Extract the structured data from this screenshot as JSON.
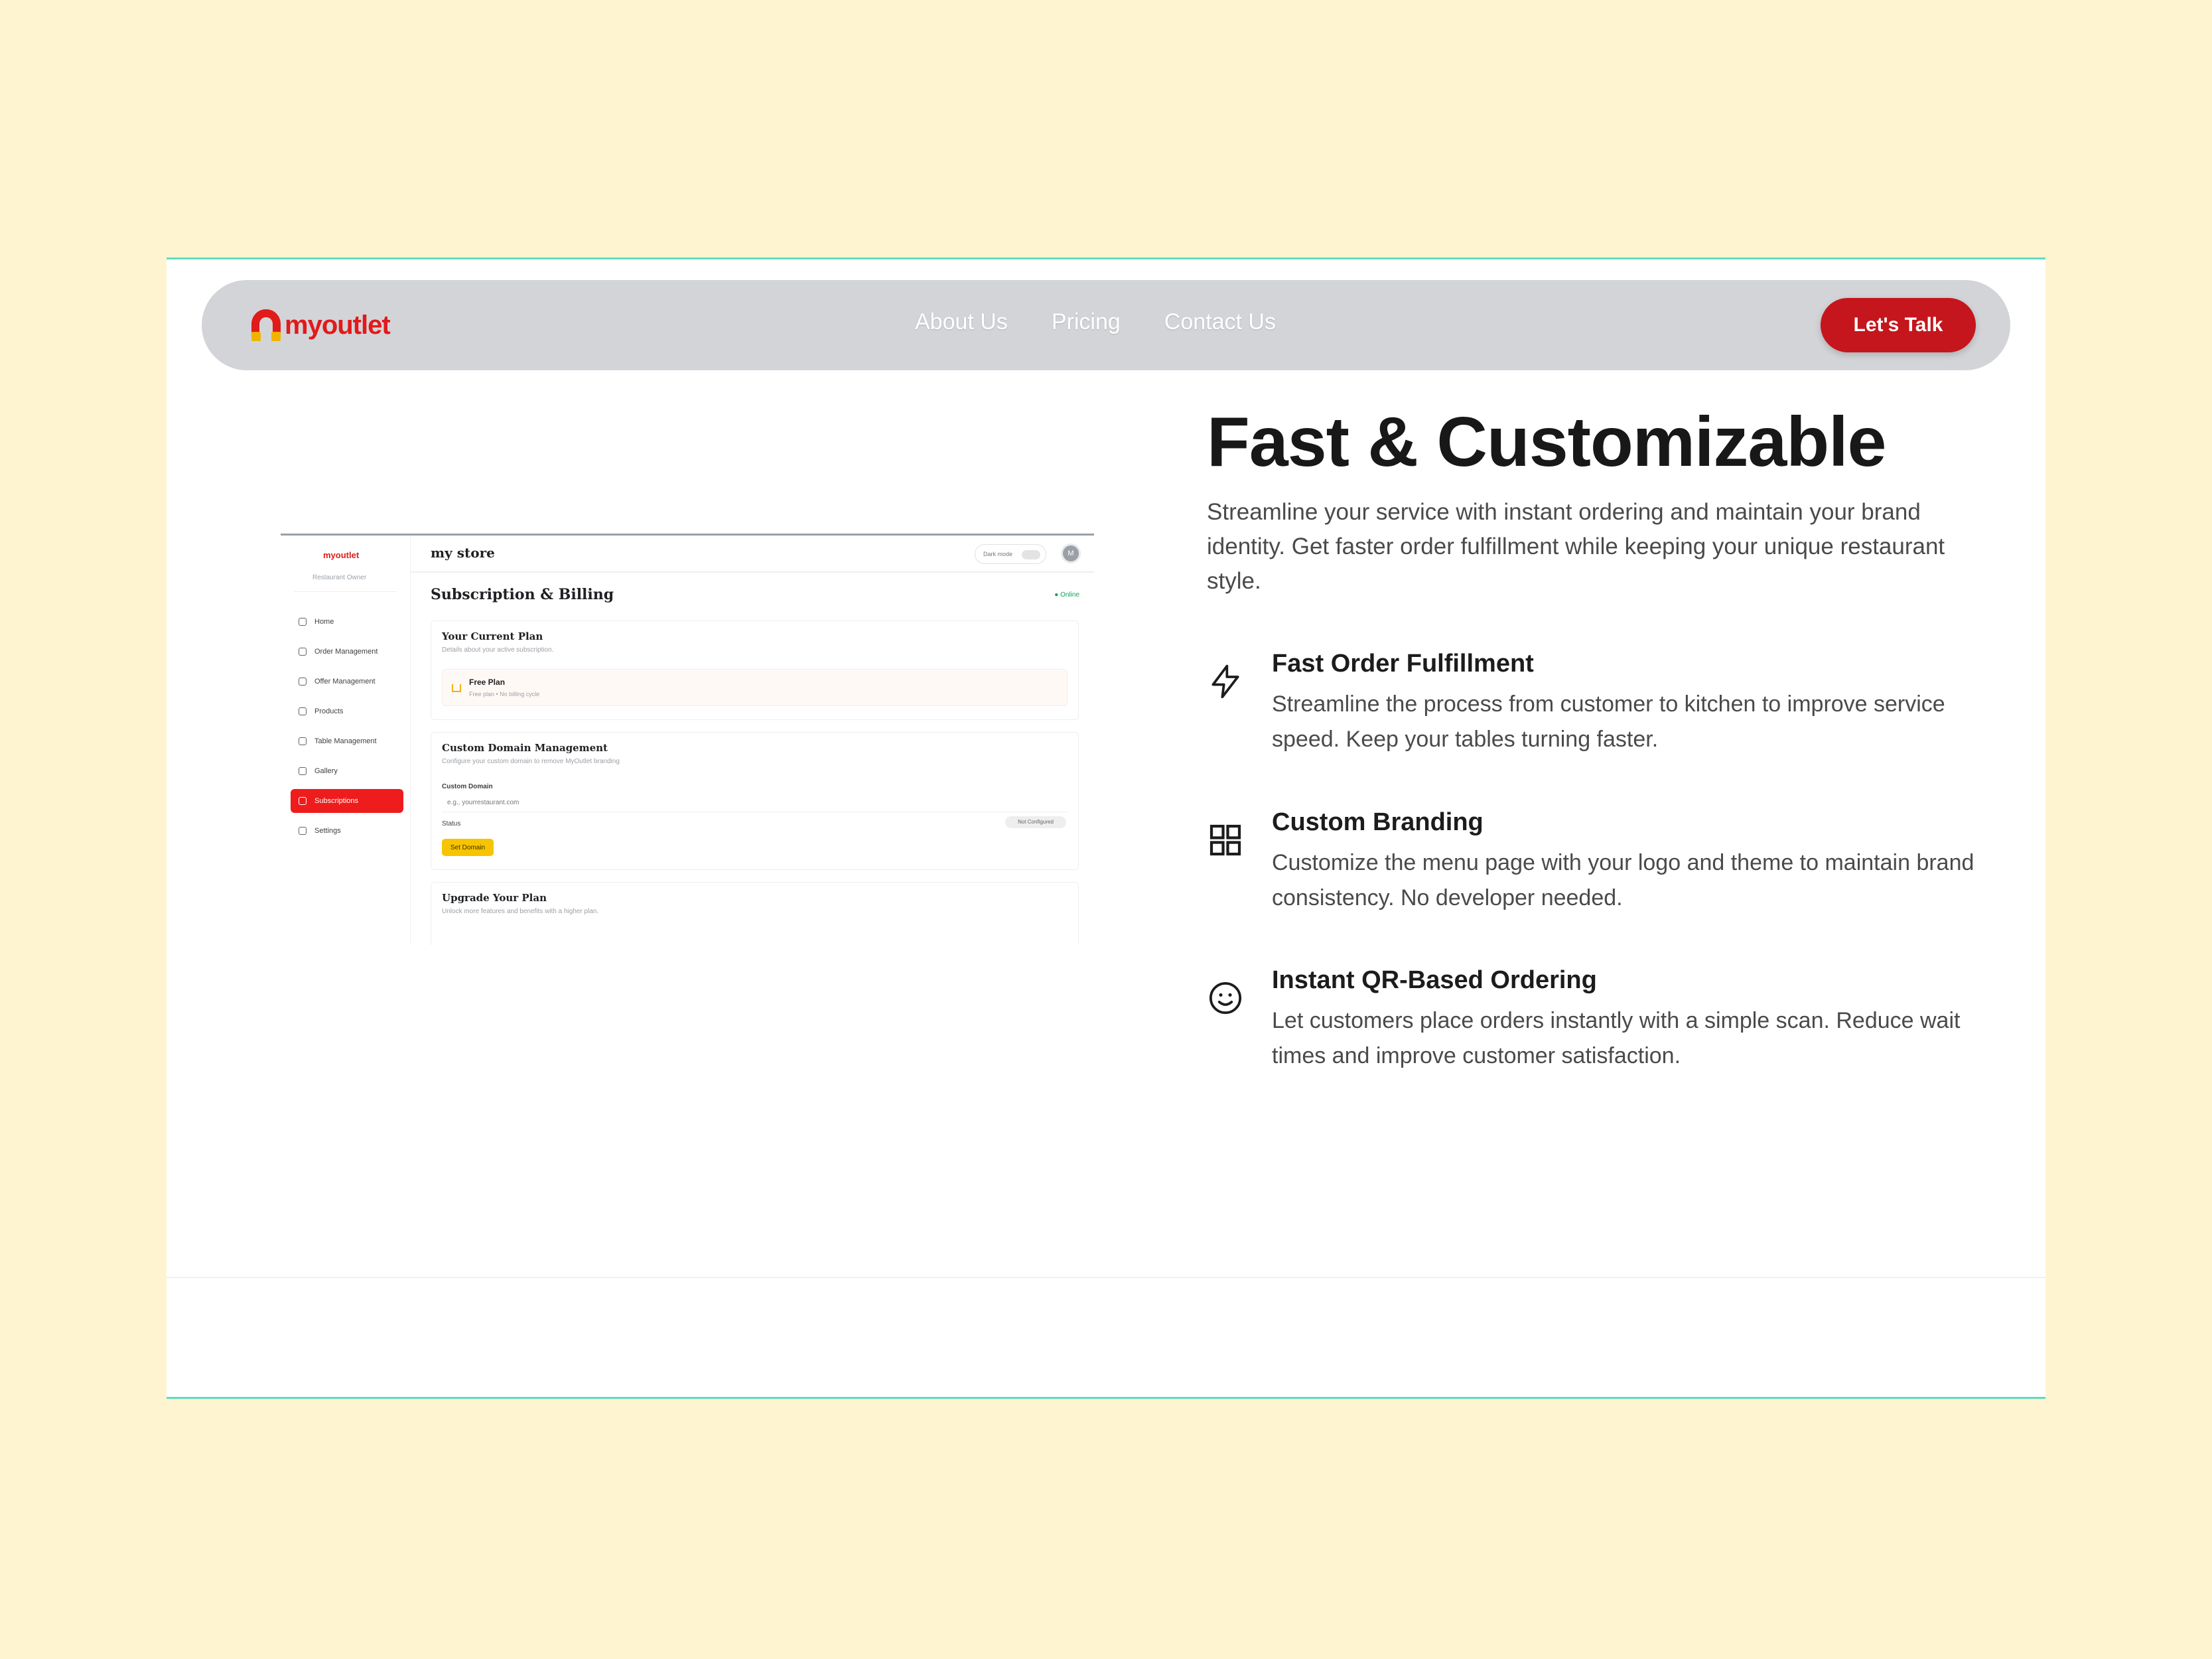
{
  "brand": {
    "name": "myoutlet",
    "color": "#e11a1a"
  },
  "nav": {
    "links": [
      "About Us",
      "Pricing",
      "Contact Us"
    ],
    "cta": "Let's Talk"
  },
  "mock": {
    "logo": "myoutlet",
    "role": "Restaurant Owner",
    "sidebar": [
      "Home",
      "Order Management",
      "Offer Management",
      "Products",
      "Table Management",
      "Gallery",
      "Subscriptions",
      "Settings"
    ],
    "active_item": "Subscriptions",
    "store_name": "my store",
    "dark_mode_label": "Dark mode",
    "avatar": "M",
    "page_title": "Subscription & Billing",
    "online": "Online",
    "current_plan": {
      "title": "Your Current Plan",
      "subtitle": "Details about your active subscription.",
      "plan_name": "Free Plan",
      "plan_sub": "Free plan • No billing cycle"
    },
    "domain": {
      "title": "Custom Domain Management",
      "subtitle": "Configure your custom domain to remove MyOutlet branding",
      "field_label": "Custom Domain",
      "placeholder": "e.g., yourrestaurant.com",
      "status_label": "Status",
      "status_badge": "Not Configured",
      "button": "Set Domain"
    },
    "upgrade": {
      "title": "Upgrade Your Plan",
      "subtitle": "Unlock more features and benefits with a higher plan."
    }
  },
  "hero": {
    "title": "Fast & Customizable",
    "description": "Streamline your service with instant ordering and maintain your brand identity. Get faster order fulfillment while keeping your unique restaurant style."
  },
  "features": [
    {
      "icon": "lightning-icon",
      "title": "Fast Order Fulfillment",
      "description": "Streamline the process from customer to kitchen to improve service speed. Keep your tables turning faster."
    },
    {
      "icon": "grid-icon",
      "title": "Custom Branding",
      "description": "Customize the menu page with your logo and theme to maintain brand consistency. No developer needed."
    },
    {
      "icon": "smiley-icon",
      "title": "Instant QR-Based Ordering",
      "description": "Let customers place orders instantly with a simple scan. Reduce wait times and improve customer satisfaction."
    }
  ]
}
